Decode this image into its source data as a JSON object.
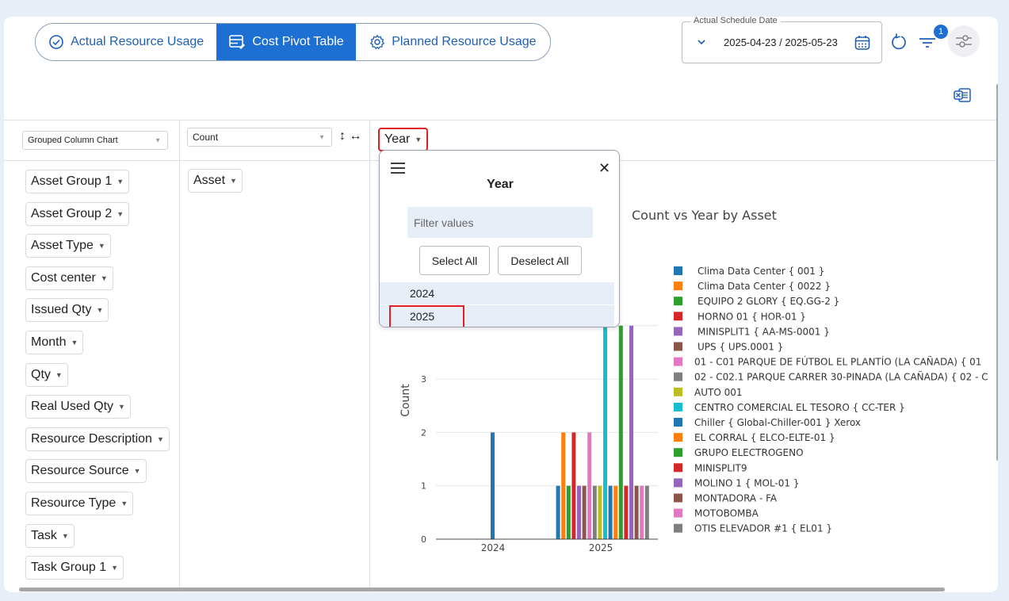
{
  "tabs": [
    {
      "label": "Actual Resource Usage",
      "icon": "check-circle-icon"
    },
    {
      "label": "Cost Pivot Table",
      "icon": "table-edit-icon"
    },
    {
      "label": "Planned Resource Usage",
      "icon": "gear-icon"
    }
  ],
  "date_filter": {
    "label": "Actual Schedule Date",
    "value": "2025-04-23 / 2025-05-23"
  },
  "filter_badge": "1",
  "pivot": {
    "renderer": "Grouped Column Chart",
    "aggregator": "Count",
    "column_attr": "Year",
    "row_attr": "Asset",
    "arrows": "↕ ↔",
    "attributes": [
      "Asset Group 1",
      "Asset Group 2",
      "Asset Type",
      "Cost center",
      "Issued Qty",
      "Month",
      "Qty",
      "Real Used Qty",
      "Resource Description",
      "Resource Source",
      "Resource Type",
      "Task",
      "Task Group 1"
    ]
  },
  "year_popup": {
    "title": "Year",
    "filter_placeholder": "Filter values",
    "select_all": "Select All",
    "deselect_all": "Deselect All",
    "options": [
      "2024",
      "2025"
    ]
  },
  "chart_data": {
    "type": "bar",
    "title": "Count vs Year by Asset",
    "ylabel": "Count",
    "xlabel": "",
    "categories": [
      "2024",
      "2025"
    ],
    "ylim": [
      0,
      4
    ],
    "yticks": [
      0,
      1,
      2,
      3
    ],
    "series": [
      {
        "name": "Clima Data Center { 001 }",
        "color": "#1f77b4",
        "values": [
          2,
          1
        ]
      },
      {
        "name": "Clima Data Center { 0022 }",
        "color": "#ff7f0e",
        "values": [
          0,
          2
        ]
      },
      {
        "name": "EQUIPO 2 GLORY { EQ.GG-2 }",
        "color": "#2ca02c",
        "values": [
          0,
          1
        ]
      },
      {
        "name": "HORNO 01 { HOR-01 }",
        "color": "#d62728",
        "values": [
          0,
          2
        ]
      },
      {
        "name": "MINISPLIT1 { AA-MS-0001 }",
        "color": "#9467bd",
        "values": [
          0,
          1
        ]
      },
      {
        "name": "UPS { UPS.0001 }",
        "color": "#8c564b",
        "values": [
          0,
          1
        ]
      },
      {
        "name": "01 - C01 PARQUE DE FÚTBOL EL PLANTÍO (LA CAÑADA) { 01",
        "color": "#e377c2",
        "values": [
          0,
          2
        ]
      },
      {
        "name": "02 - C02.1 PARQUE CARRER 30-PINADA (LA CAÑADA) { 02 - C",
        "color": "#7f7f7f",
        "values": [
          0,
          1
        ]
      },
      {
        "name": "AUTO 001",
        "color": "#bcbd22",
        "values": [
          0,
          1
        ]
      },
      {
        "name": "CENTRO COMERCIAL EL TESORO { CC-TER }",
        "color": "#17becf",
        "values": [
          0,
          4
        ]
      },
      {
        "name": "Chiller { Global-Chiller-001 } Xerox",
        "color": "#1f77b4",
        "values": [
          0,
          1
        ]
      },
      {
        "name": "EL CORRAL { ELCO-ELTE-01 }",
        "color": "#ff7f0e",
        "values": [
          0,
          1
        ]
      },
      {
        "name": "GRUPO ELECTROGENO",
        "color": "#2ca02c",
        "values": [
          0,
          4
        ]
      },
      {
        "name": "MINISPLIT9",
        "color": "#d62728",
        "values": [
          0,
          1
        ]
      },
      {
        "name": "MOLINO 1 { MOL-01 }",
        "color": "#9467bd",
        "values": [
          0,
          4
        ]
      },
      {
        "name": "MONTADORA - FA",
        "color": "#8c564b",
        "values": [
          0,
          1
        ]
      },
      {
        "name": "MOTOBOMBA",
        "color": "#e377c2",
        "values": [
          0,
          1
        ]
      },
      {
        "name": "OTIS ELEVADOR #1 { EL01 }",
        "color": "#7f7f7f",
        "values": [
          0,
          1
        ]
      }
    ]
  }
}
